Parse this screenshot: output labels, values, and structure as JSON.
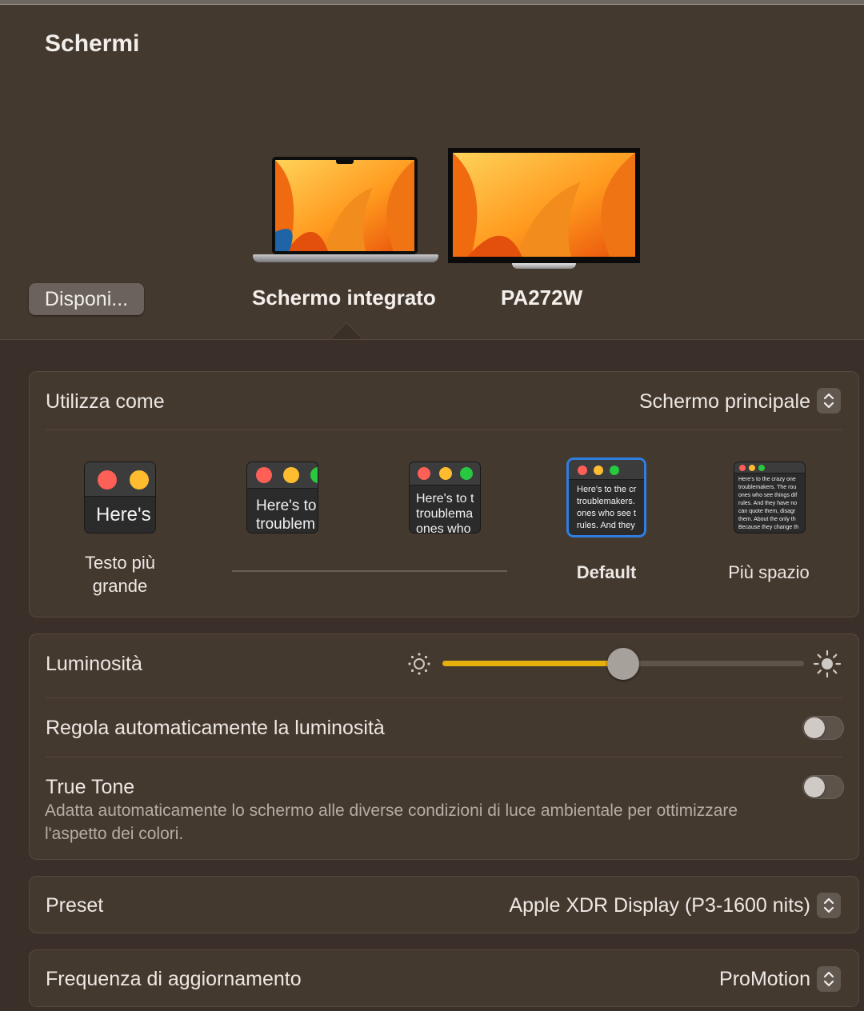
{
  "window": {
    "title": "Schermi"
  },
  "arrange_button": {
    "label": "Disponi..."
  },
  "displays": [
    {
      "name": "Schermo integrato",
      "type": "laptop",
      "selected": true
    },
    {
      "name": "PA272W",
      "type": "monitor",
      "selected": false
    }
  ],
  "use_as": {
    "label": "Utilizza come",
    "value": "Schermo principale"
  },
  "resolution": {
    "options": [
      {
        "label": "Testo più grande",
        "preview": "Here's"
      },
      {
        "label": "",
        "preview": "Here's to\ntroublem"
      },
      {
        "label": "",
        "preview": "Here's to t\ntroublema\nones who"
      },
      {
        "label": "Default",
        "preview": "Here's to the cr\ntroublemakers.\nones who see t\nrules. And they",
        "selected": true
      },
      {
        "label": "Più spazio",
        "preview": "Here's to the crazy one\ntroublemakers. The rou\nones who see things dif\nrules. And they have no\ncan quote them, disagr\nthem. About the only th\nBecause they change th"
      }
    ]
  },
  "brightness": {
    "label": "Luminosità",
    "level_fraction": 0.5
  },
  "auto_brightness": {
    "label": "Regola automaticamente la luminosità",
    "enabled": false
  },
  "true_tone": {
    "label": "True Tone",
    "description": "Adatta automaticamente lo schermo alle diverse condizioni di luce ambientale per ottimizzare l'aspetto dei colori.",
    "enabled": false
  },
  "preset": {
    "label": "Preset",
    "value": "Apple XDR Display (P3-1600 nits)"
  },
  "refresh_rate": {
    "label": "Frequenza di aggiornamento",
    "value": "ProMotion"
  },
  "colors": {
    "accent": "#e5b00c",
    "selection": "#2f7ee0",
    "background": "#3b3029"
  }
}
